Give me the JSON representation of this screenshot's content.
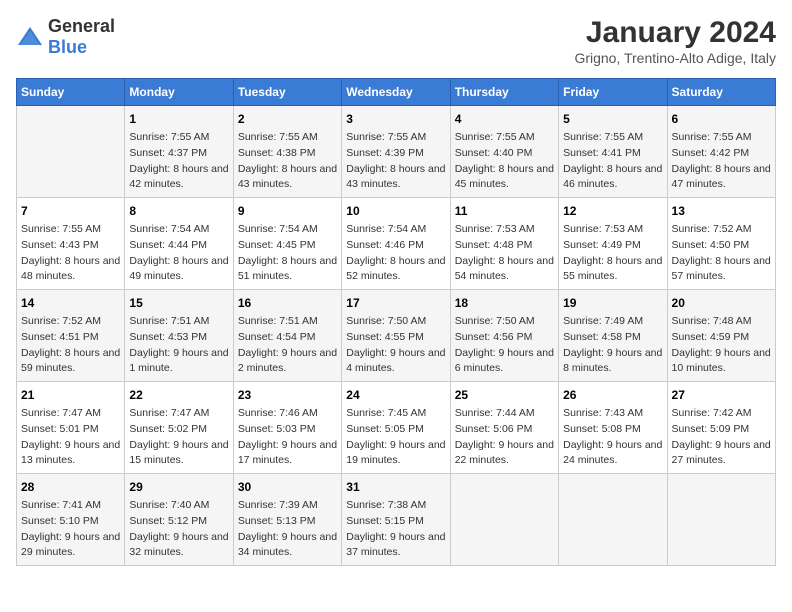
{
  "logo": {
    "general": "General",
    "blue": "Blue"
  },
  "title": "January 2024",
  "subtitle": "Grigno, Trentino-Alto Adige, Italy",
  "headers": [
    "Sunday",
    "Monday",
    "Tuesday",
    "Wednesday",
    "Thursday",
    "Friday",
    "Saturday"
  ],
  "weeks": [
    [
      {
        "day": "",
        "sunrise": "",
        "sunset": "",
        "daylight": ""
      },
      {
        "day": "1",
        "sunrise": "Sunrise: 7:55 AM",
        "sunset": "Sunset: 4:37 PM",
        "daylight": "Daylight: 8 hours and 42 minutes."
      },
      {
        "day": "2",
        "sunrise": "Sunrise: 7:55 AM",
        "sunset": "Sunset: 4:38 PM",
        "daylight": "Daylight: 8 hours and 43 minutes."
      },
      {
        "day": "3",
        "sunrise": "Sunrise: 7:55 AM",
        "sunset": "Sunset: 4:39 PM",
        "daylight": "Daylight: 8 hours and 43 minutes."
      },
      {
        "day": "4",
        "sunrise": "Sunrise: 7:55 AM",
        "sunset": "Sunset: 4:40 PM",
        "daylight": "Daylight: 8 hours and 45 minutes."
      },
      {
        "day": "5",
        "sunrise": "Sunrise: 7:55 AM",
        "sunset": "Sunset: 4:41 PM",
        "daylight": "Daylight: 8 hours and 46 minutes."
      },
      {
        "day": "6",
        "sunrise": "Sunrise: 7:55 AM",
        "sunset": "Sunset: 4:42 PM",
        "daylight": "Daylight: 8 hours and 47 minutes."
      }
    ],
    [
      {
        "day": "7",
        "sunrise": "Sunrise: 7:55 AM",
        "sunset": "Sunset: 4:43 PM",
        "daylight": "Daylight: 8 hours and 48 minutes."
      },
      {
        "day": "8",
        "sunrise": "Sunrise: 7:54 AM",
        "sunset": "Sunset: 4:44 PM",
        "daylight": "Daylight: 8 hours and 49 minutes."
      },
      {
        "day": "9",
        "sunrise": "Sunrise: 7:54 AM",
        "sunset": "Sunset: 4:45 PM",
        "daylight": "Daylight: 8 hours and 51 minutes."
      },
      {
        "day": "10",
        "sunrise": "Sunrise: 7:54 AM",
        "sunset": "Sunset: 4:46 PM",
        "daylight": "Daylight: 8 hours and 52 minutes."
      },
      {
        "day": "11",
        "sunrise": "Sunrise: 7:53 AM",
        "sunset": "Sunset: 4:48 PM",
        "daylight": "Daylight: 8 hours and 54 minutes."
      },
      {
        "day": "12",
        "sunrise": "Sunrise: 7:53 AM",
        "sunset": "Sunset: 4:49 PM",
        "daylight": "Daylight: 8 hours and 55 minutes."
      },
      {
        "day": "13",
        "sunrise": "Sunrise: 7:52 AM",
        "sunset": "Sunset: 4:50 PM",
        "daylight": "Daylight: 8 hours and 57 minutes."
      }
    ],
    [
      {
        "day": "14",
        "sunrise": "Sunrise: 7:52 AM",
        "sunset": "Sunset: 4:51 PM",
        "daylight": "Daylight: 8 hours and 59 minutes."
      },
      {
        "day": "15",
        "sunrise": "Sunrise: 7:51 AM",
        "sunset": "Sunset: 4:53 PM",
        "daylight": "Daylight: 9 hours and 1 minute."
      },
      {
        "day": "16",
        "sunrise": "Sunrise: 7:51 AM",
        "sunset": "Sunset: 4:54 PM",
        "daylight": "Daylight: 9 hours and 2 minutes."
      },
      {
        "day": "17",
        "sunrise": "Sunrise: 7:50 AM",
        "sunset": "Sunset: 4:55 PM",
        "daylight": "Daylight: 9 hours and 4 minutes."
      },
      {
        "day": "18",
        "sunrise": "Sunrise: 7:50 AM",
        "sunset": "Sunset: 4:56 PM",
        "daylight": "Daylight: 9 hours and 6 minutes."
      },
      {
        "day": "19",
        "sunrise": "Sunrise: 7:49 AM",
        "sunset": "Sunset: 4:58 PM",
        "daylight": "Daylight: 9 hours and 8 minutes."
      },
      {
        "day": "20",
        "sunrise": "Sunrise: 7:48 AM",
        "sunset": "Sunset: 4:59 PM",
        "daylight": "Daylight: 9 hours and 10 minutes."
      }
    ],
    [
      {
        "day": "21",
        "sunrise": "Sunrise: 7:47 AM",
        "sunset": "Sunset: 5:01 PM",
        "daylight": "Daylight: 9 hours and 13 minutes."
      },
      {
        "day": "22",
        "sunrise": "Sunrise: 7:47 AM",
        "sunset": "Sunset: 5:02 PM",
        "daylight": "Daylight: 9 hours and 15 minutes."
      },
      {
        "day": "23",
        "sunrise": "Sunrise: 7:46 AM",
        "sunset": "Sunset: 5:03 PM",
        "daylight": "Daylight: 9 hours and 17 minutes."
      },
      {
        "day": "24",
        "sunrise": "Sunrise: 7:45 AM",
        "sunset": "Sunset: 5:05 PM",
        "daylight": "Daylight: 9 hours and 19 minutes."
      },
      {
        "day": "25",
        "sunrise": "Sunrise: 7:44 AM",
        "sunset": "Sunset: 5:06 PM",
        "daylight": "Daylight: 9 hours and 22 minutes."
      },
      {
        "day": "26",
        "sunrise": "Sunrise: 7:43 AM",
        "sunset": "Sunset: 5:08 PM",
        "daylight": "Daylight: 9 hours and 24 minutes."
      },
      {
        "day": "27",
        "sunrise": "Sunrise: 7:42 AM",
        "sunset": "Sunset: 5:09 PM",
        "daylight": "Daylight: 9 hours and 27 minutes."
      }
    ],
    [
      {
        "day": "28",
        "sunrise": "Sunrise: 7:41 AM",
        "sunset": "Sunset: 5:10 PM",
        "daylight": "Daylight: 9 hours and 29 minutes."
      },
      {
        "day": "29",
        "sunrise": "Sunrise: 7:40 AM",
        "sunset": "Sunset: 5:12 PM",
        "daylight": "Daylight: 9 hours and 32 minutes."
      },
      {
        "day": "30",
        "sunrise": "Sunrise: 7:39 AM",
        "sunset": "Sunset: 5:13 PM",
        "daylight": "Daylight: 9 hours and 34 minutes."
      },
      {
        "day": "31",
        "sunrise": "Sunrise: 7:38 AM",
        "sunset": "Sunset: 5:15 PM",
        "daylight": "Daylight: 9 hours and 37 minutes."
      },
      {
        "day": "",
        "sunrise": "",
        "sunset": "",
        "daylight": ""
      },
      {
        "day": "",
        "sunrise": "",
        "sunset": "",
        "daylight": ""
      },
      {
        "day": "",
        "sunrise": "",
        "sunset": "",
        "daylight": ""
      }
    ]
  ]
}
